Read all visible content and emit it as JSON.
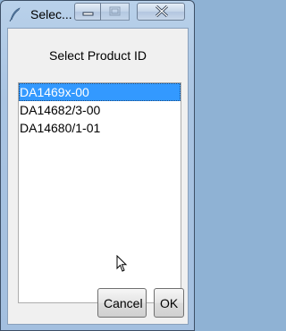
{
  "window": {
    "title": "Selec...",
    "icon": "feather-icon",
    "controls": {
      "minimize": "minimize-icon",
      "maximize": "maximize-icon",
      "close": "close-icon"
    }
  },
  "dialog": {
    "heading": "Select Product ID",
    "list": {
      "items": [
        "DA1469x-00",
        "DA14682/3-00",
        "DA14680/1-01"
      ],
      "selected_index": 0
    },
    "buttons": {
      "cancel_label": "Cancel",
      "ok_label": "OK"
    }
  },
  "colors": {
    "selection": "#3399ff",
    "titlebar": "#b9d1ea"
  }
}
